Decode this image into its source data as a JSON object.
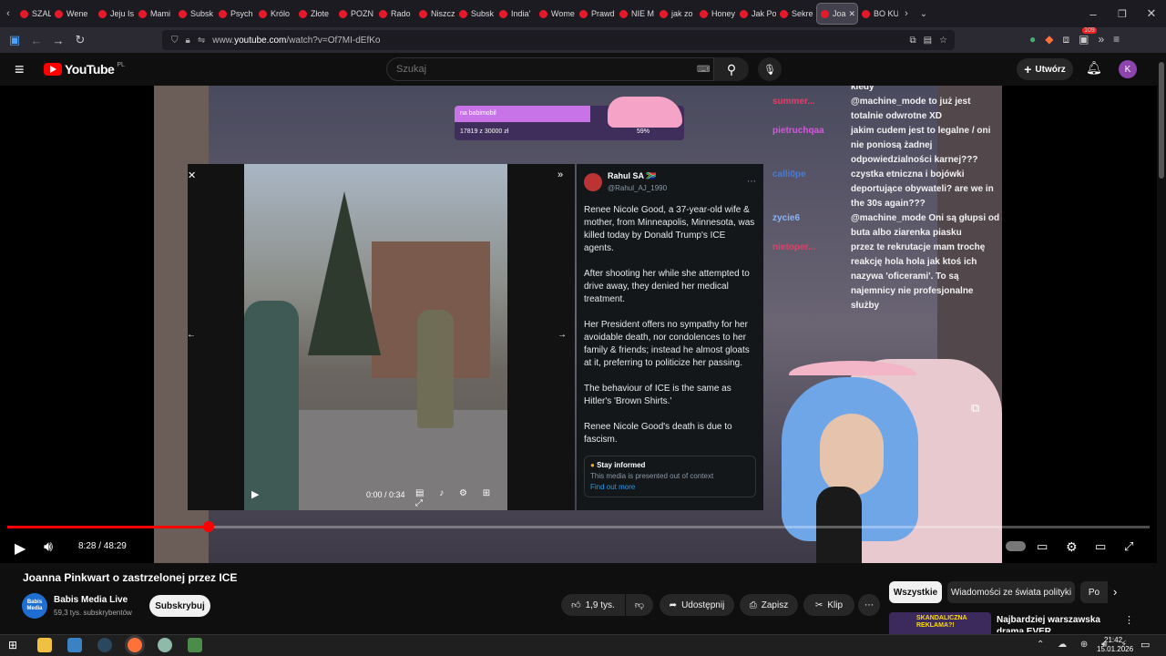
{
  "browser": {
    "tabs": [
      {
        "label": "SZALO"
      },
      {
        "label": "Wene"
      },
      {
        "label": "Jeju Is"
      },
      {
        "label": "Mami"
      },
      {
        "label": "Subsk"
      },
      {
        "label": "Psych"
      },
      {
        "label": "Królo"
      },
      {
        "label": "Złote"
      },
      {
        "label": "POZN"
      },
      {
        "label": "Rado"
      },
      {
        "label": "Niszcz"
      },
      {
        "label": "Subsk"
      },
      {
        "label": "India'"
      },
      {
        "label": "Wome"
      },
      {
        "label": "Prawd"
      },
      {
        "label": "NIE M"
      },
      {
        "label": "jak zo"
      },
      {
        "label": "Honey"
      },
      {
        "label": "Jak Po"
      },
      {
        "label": "Sekre"
      },
      {
        "label": "Joa",
        "active": true
      },
      {
        "label": "BO KU"
      }
    ],
    "url_prefix": "www.",
    "url_host": "youtube.com",
    "url_path": "/watch?v=Of7MI-dEfKo",
    "extension_badge": "109"
  },
  "youtube": {
    "logo_text": "YouTube",
    "logo_region": "PL",
    "search_placeholder": "Szukaj",
    "create_label": "Utwórz",
    "avatar_letter": "K"
  },
  "video": {
    "overlay": {
      "goal_title": "na babimobil",
      "goal_progress": "17819 z 30000 zł",
      "goal_percent": "59%",
      "goal_fill": 0.59
    },
    "embedded_player": {
      "time": "0:00 / 0:34"
    },
    "tweet": {
      "author": "Rahul SA 🇿🇦",
      "handle": "@Rahul_AJ_1990",
      "paragraphs": [
        "Renee Nicole Good, a 37-year-old wife & mother, from Minneapolis, Minnesota, was killed today by Donald Trump's ICE agents.",
        "After shooting her while she  attempted to drive away, they denied her medical treatment.",
        "Her President offers no sympathy for her avoidable death, nor condolences to her family & friends; instead he almost gloats at it, preferring to politicize her passing.",
        "The behaviour of ICE is the same as Hitler's 'Brown Shirts.'",
        "Renee Nicole Good's death is due to fascism."
      ],
      "notice_title": "Stay informed",
      "notice_text": "This media is presented out of context",
      "notice_link": "Find out more"
    },
    "chat": {
      "names": [
        {
          "text": "summer...",
          "color": "#e0406a"
        },
        {
          "text": "pietruchqaa",
          "color": "#d05ad8"
        },
        {
          "text": "calli0pe",
          "color": "#4a7bd1"
        },
        {
          "text": "zycie6",
          "color": "#8ab4f8"
        },
        {
          "text": "nietoper...",
          "color": "#e0406a"
        }
      ],
      "lines": [
        "kiedy",
        "@machine_mode to już jest totalnie odwrotne XD",
        "jakim cudem jest to legalne / oni nie poniosą żadnej odpowiedzialności karnej???",
        "czystka etniczna i bojówki deportujące obywateli? are we in the 30s again???",
        "@machine_mode Oni są głupsi od buta albo ziarenka piasku",
        "przez te rekrutacje mam trochę reakcję hola hola jak ktoś ich nazywa 'oficerami'. To są najemnicy nie profesjonalne służby"
      ]
    },
    "progress_fraction": 0.176,
    "time_display": "8:28 / 48:29"
  },
  "below": {
    "title": "Joanna Pinkwart o zastrzelonej przez ICE",
    "channel_name": "Babis Media Live",
    "subscribers": "59,3 tys. subskrybentów",
    "channel_avatar_text": "Babis Media",
    "subscribe_label": "Subskrybuj",
    "likes": "1,9 tys.",
    "share_label": "Udostępnij",
    "save_label": "Zapisz",
    "clip_label": "Klip",
    "filters": [
      "Wszystkie",
      "Wiadomości ze świata polityki",
      "Po"
    ],
    "rec_title": "Najbardziej warszawska drama EVER",
    "rec_thumb_text": "SKANDALICZNA REKLAMA?!"
  },
  "taskbar": {
    "time": "21:42",
    "date": "15.01.2026"
  },
  "colors": {
    "accent_red": "#ff0000",
    "avatar_purple": "#8e44ad"
  }
}
